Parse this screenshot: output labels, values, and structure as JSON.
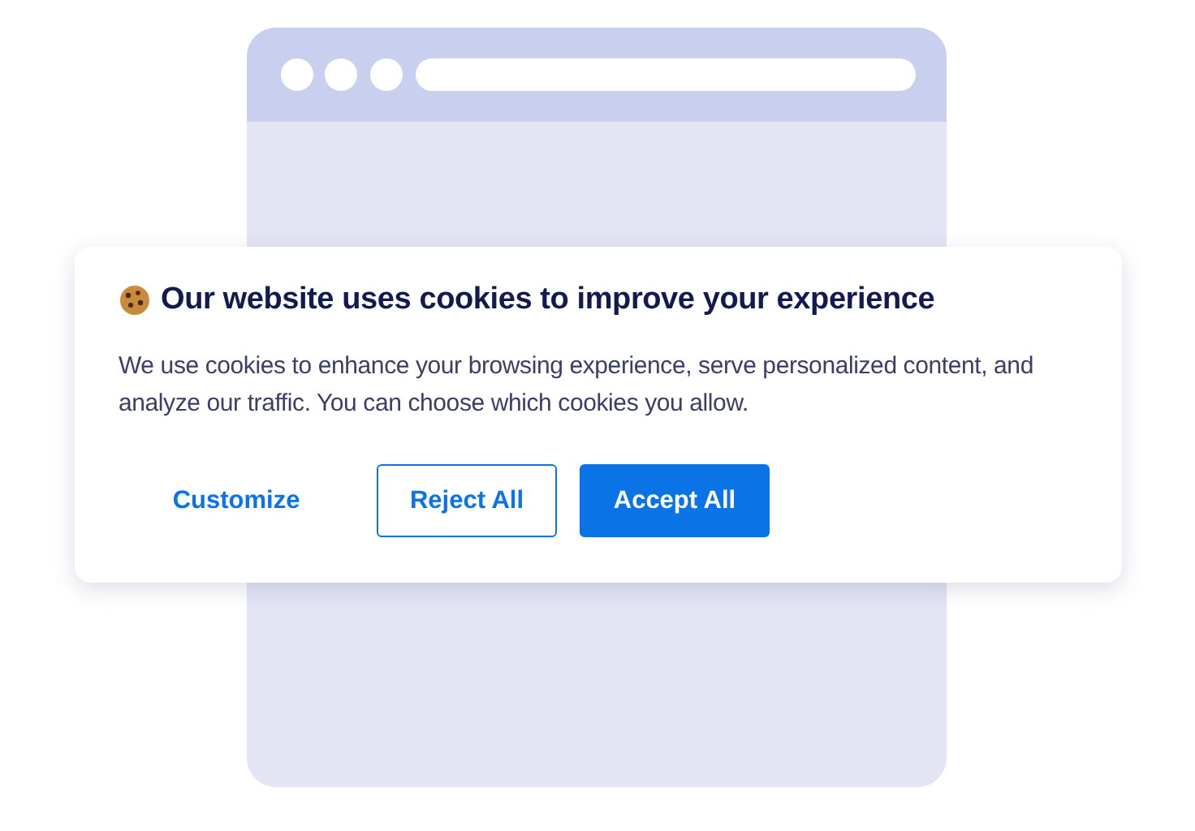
{
  "banner": {
    "title": "Our website uses cookies to improve your experience",
    "message": "We use cookies to enhance your browsing experience, serve personalized content, and analyze our traffic. You can choose which cookies you allow.",
    "buttons": [
      {
        "label": "Customize",
        "kind": "link"
      },
      {
        "label": "Reject All",
        "kind": "outline"
      },
      {
        "label": "Accept All",
        "kind": "primary"
      }
    ]
  }
}
